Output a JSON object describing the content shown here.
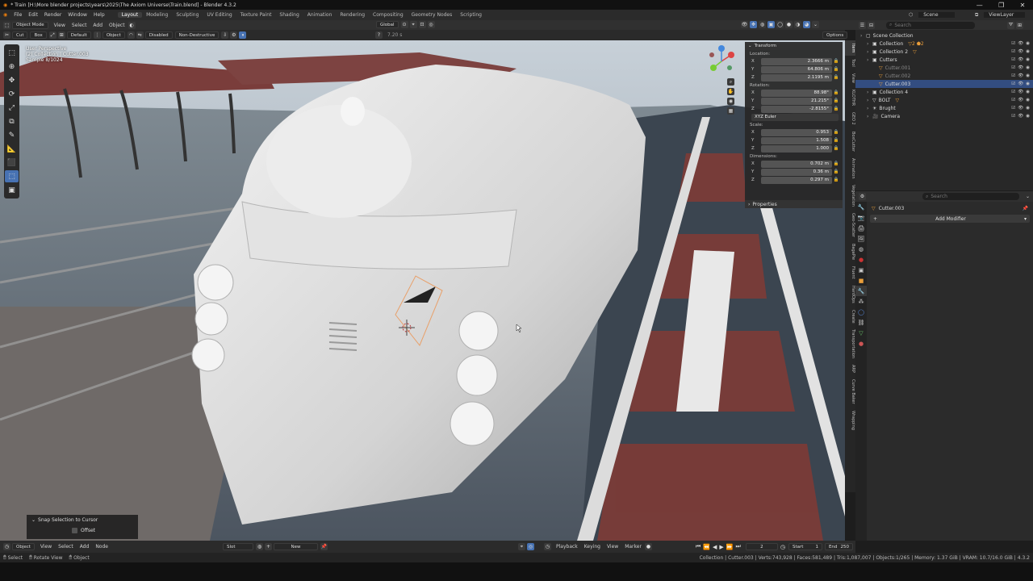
{
  "title_bar": {
    "text": "* Train [H:\\More blender projects\\years\\2025\\The Axiom Universe\\Train.blend] - Blender 4.3.2",
    "controls": [
      "—",
      "❐",
      "✕"
    ]
  },
  "menu": {
    "items": [
      "File",
      "Edit",
      "Render",
      "Window",
      "Help"
    ],
    "workspaces": [
      "Layout",
      "Modeling",
      "Sculpting",
      "UV Editing",
      "Texture Paint",
      "Shading",
      "Animation",
      "Rendering",
      "Compositing",
      "Geometry Nodes",
      "Scripting"
    ],
    "active_workspace": "Layout",
    "scene": "Scene",
    "view_layer": "ViewLayer"
  },
  "viewport_header": {
    "mode": "Object Mode",
    "menus": [
      "View",
      "Select",
      "Add",
      "Object"
    ],
    "orientation": "Global",
    "options": "Options"
  },
  "tool_header": {
    "cut": "Cut",
    "box": "Box",
    "default": "Default",
    "object": "Object",
    "disabled": "Disabled",
    "non_destructive": "Non-Destructive",
    "count": "7.20 s"
  },
  "viewport_info": {
    "line1": "User Perspective",
    "line2": "(2) Collection | Cutter.003",
    "line3": "Sample 8/1024"
  },
  "toolbar": [
    "⬚",
    "⊕",
    "✥",
    "⟳",
    "⤢",
    "⧉",
    "✎",
    "📐",
    "⬛",
    "⬚",
    "▣"
  ],
  "n_panel": {
    "header": "Transform",
    "location_label": "Location:",
    "location": {
      "x": "2.3666 m",
      "y": "64.806 m",
      "z": "2.1195 m"
    },
    "rotation_label": "Rotation:",
    "rotation": {
      "x": "88.98°",
      "y": "21.215°",
      "z": "-2.8155°"
    },
    "rotation_mode": "XYZ Euler",
    "scale_label": "Scale:",
    "scale": {
      "x": "0.953",
      "y": "1.508",
      "z": "1.000"
    },
    "dimensions_label": "Dimensions:",
    "dimensions": {
      "x": "0.702 m",
      "y": "0.36 m",
      "z": "0.297 m"
    },
    "properties": "Properties"
  },
  "side_tabs": [
    "Item",
    "Tool",
    "View",
    "KLOTHR",
    "GEO 2",
    "BoxCutter",
    "Animation",
    "Vegetation",
    "Geo-Scatter",
    "BagaPie",
    "Fluent",
    "HardOps",
    "Create",
    "Transportation",
    "ARP",
    "Curve Baker",
    "Wrapping"
  ],
  "snap_panel": {
    "title": "Snap Selection to Cursor",
    "option": "Offset"
  },
  "timeline": {
    "menus": [
      "Playback",
      "Keying",
      "View",
      "Marker"
    ],
    "current_frame": "2",
    "start_label": "Start",
    "start": "1",
    "end_label": "End",
    "end": "250",
    "left_menus": [
      "Object",
      "View",
      "Select",
      "Add",
      "Node"
    ],
    "slot": "Slot",
    "new": "New"
  },
  "status_bar": {
    "left": [
      "Select",
      "Rotate View",
      "Object"
    ],
    "right": "Collection | Cutter.003 | Verts:743,928 | Faces:581,489 | Tris:1,087,007 | Objects:1/265 | Memory: 1.37 GiB | VRAM: 10.7/16.0 GiB | 4.3.2"
  },
  "outliner": {
    "search_placeholder": "Search",
    "items": [
      {
        "name": "Scene Collection",
        "depth": 0,
        "icon": "▢"
      },
      {
        "name": "Collection",
        "depth": 1,
        "icon": "▣",
        "badge": "▽2 ⬟2"
      },
      {
        "name": "Collection 2",
        "depth": 1,
        "icon": "▣",
        "badge": "▽"
      },
      {
        "name": "Cutters",
        "depth": 1,
        "icon": "▣"
      },
      {
        "name": "Cutter.001",
        "depth": 2,
        "icon": "▽",
        "dim": true
      },
      {
        "name": "Cutter.002",
        "depth": 2,
        "icon": "▽",
        "dim": true
      },
      {
        "name": "Cutter.003",
        "depth": 2,
        "icon": "▽",
        "selected": true
      },
      {
        "name": "Collection 4",
        "depth": 1,
        "icon": "▣"
      },
      {
        "name": "BOLT",
        "depth": 1,
        "icon": "▽",
        "badge": "▽"
      },
      {
        "name": "Brught",
        "depth": 1,
        "icon": "☀"
      },
      {
        "name": "Camera",
        "depth": 1,
        "icon": "🎥"
      }
    ]
  },
  "properties": {
    "object_name": "Cutter.003",
    "add_modifier": "Add Modifier",
    "search_placeholder": "Search"
  }
}
